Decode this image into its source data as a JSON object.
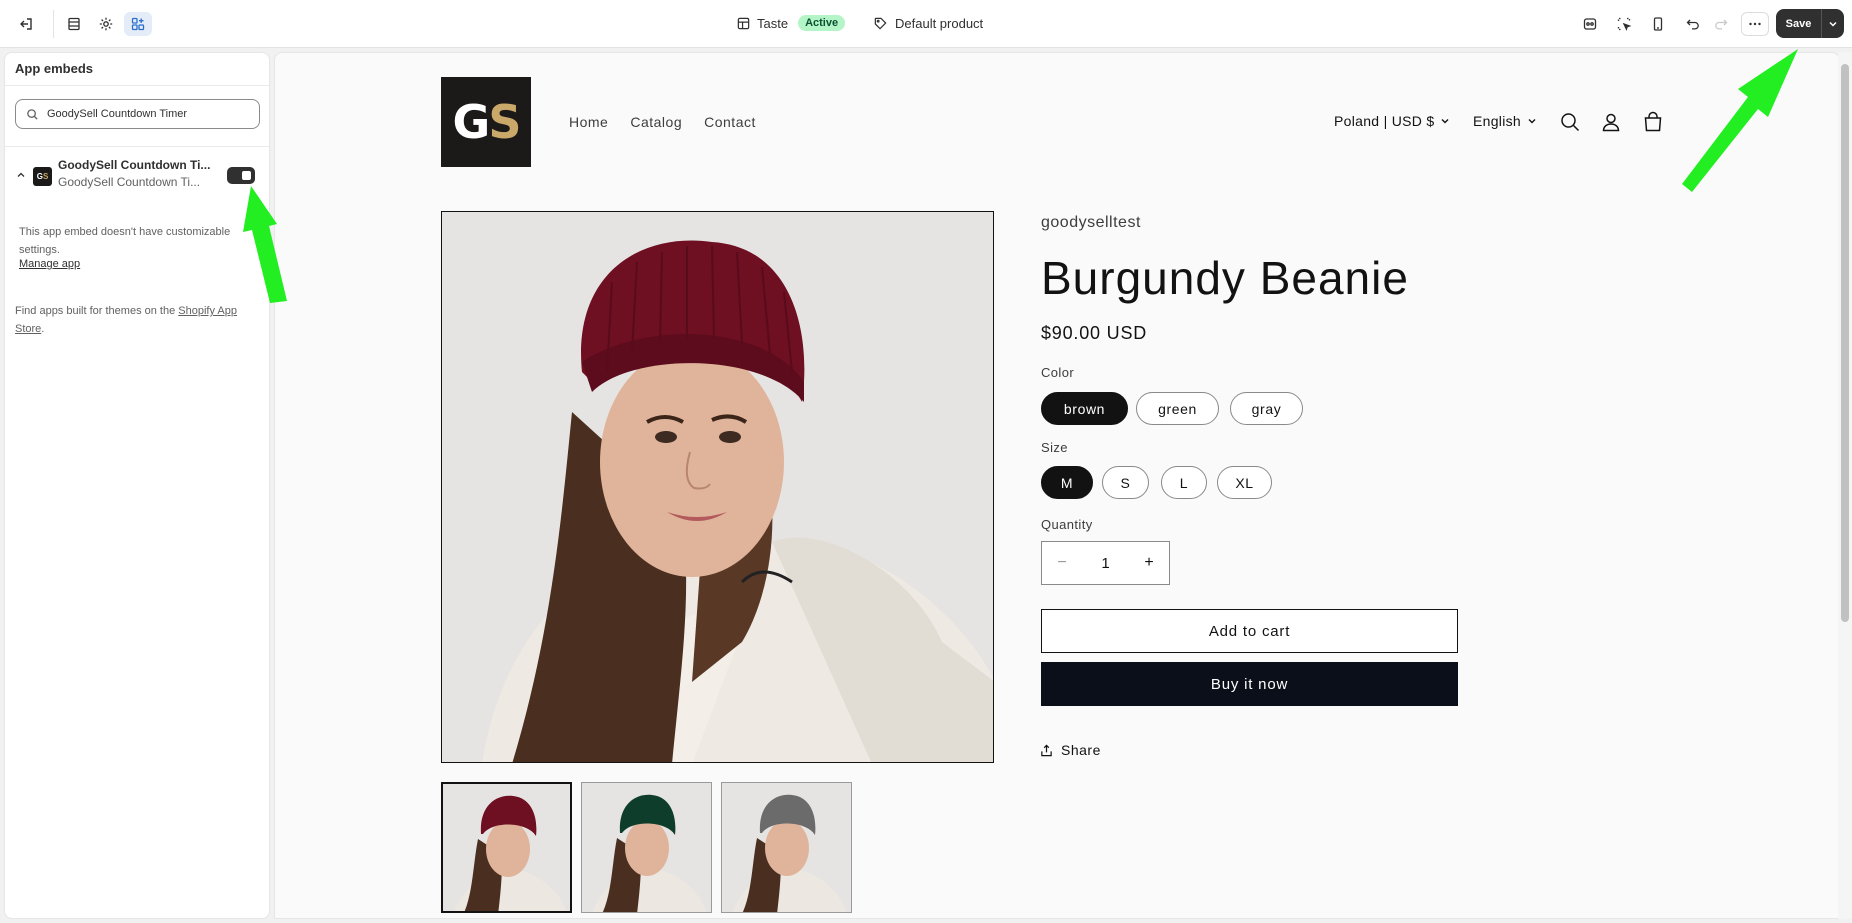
{
  "topbar": {
    "theme_name": "Taste",
    "theme_status": "Active",
    "template_name": "Default product",
    "save_label": "Save"
  },
  "sidebar": {
    "title": "App embeds",
    "search_value": "GoodySell Countdown Timer",
    "embed": {
      "name": "GoodySell Countdown Ti...",
      "subtitle": "GoodySell Countdown Ti...",
      "enabled": true
    },
    "note": "This app embed doesn't have customizable settings.",
    "manage_link": "Manage app",
    "find_prefix": "Find apps built for themes on the ",
    "find_link": "Shopify App Store",
    "find_suffix": "."
  },
  "store": {
    "logo": {
      "g": "G",
      "s": "S"
    },
    "nav": [
      "Home",
      "Catalog",
      "Contact"
    ],
    "country": "Poland | USD $",
    "language": "English"
  },
  "product": {
    "vendor": "goodyselltest",
    "title": "Burgundy Beanie",
    "price": "$90.00 USD",
    "color_label": "Color",
    "colors": [
      "brown",
      "green",
      "gray"
    ],
    "selected_color": "brown",
    "size_label": "Size",
    "sizes": [
      "M",
      "S",
      "L",
      "XL"
    ],
    "selected_size": "M",
    "quantity_label": "Quantity",
    "quantity": "1",
    "minus": "−",
    "plus": "+",
    "add_to_cart": "Add to cart",
    "buy_now": "Buy it now",
    "share": "Share"
  },
  "colors": {
    "accent_green": "#22ee22",
    "burgundy": "#6e0f22",
    "green_beanie": "#0f3d2b",
    "gray_beanie": "#6b6b6b",
    "toggle_on": "#303030"
  }
}
